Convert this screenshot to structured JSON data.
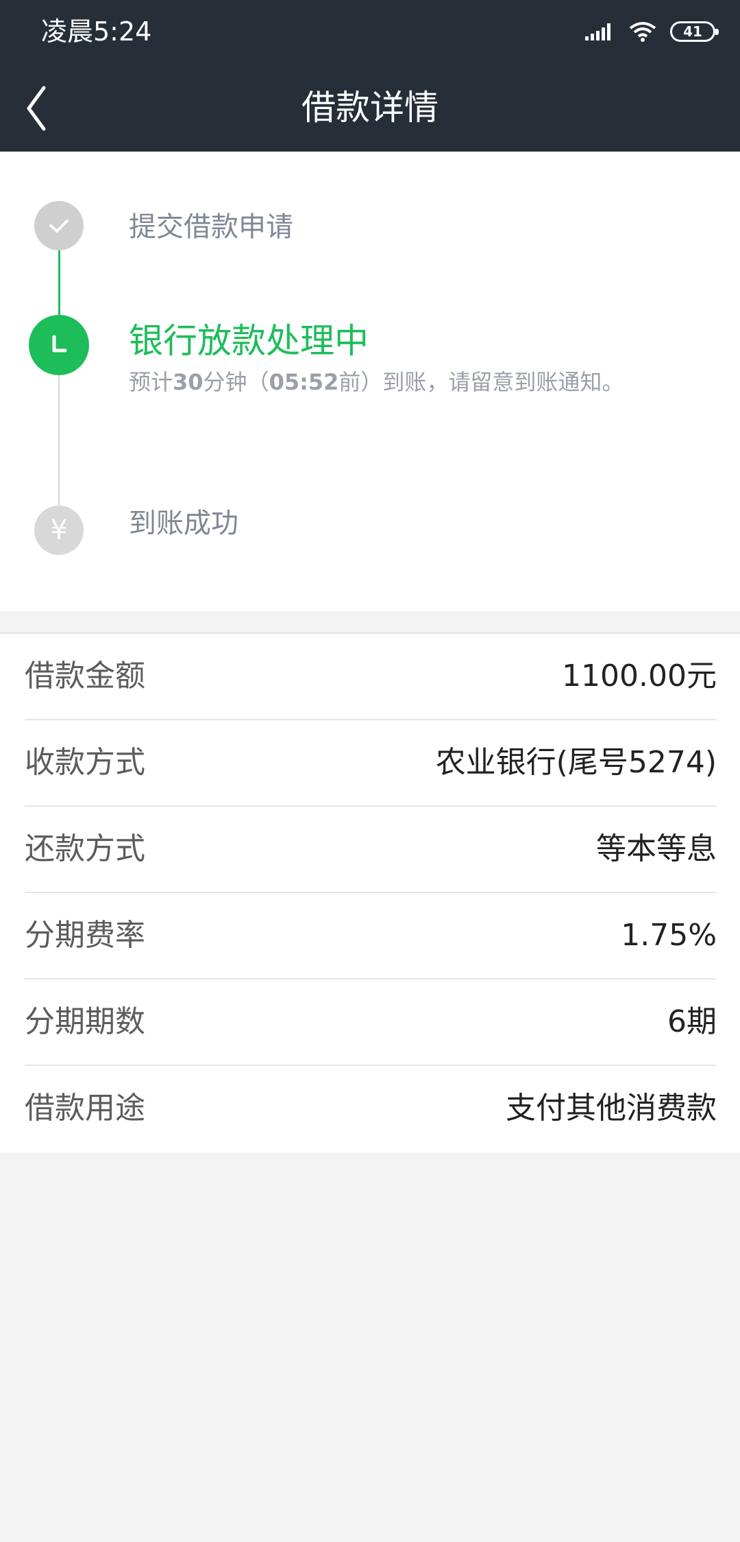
{
  "status_bar": {
    "time": "凌晨5:24",
    "battery": "41"
  },
  "header": {
    "title": "借款详情"
  },
  "timeline": {
    "step1": "提交借款申请",
    "step2": "银行放款处理中",
    "step2_note": {
      "prefix": "预计",
      "minutes": "30",
      "mid": "分钟（",
      "deadline": "05:52",
      "suffix": "前）到账，请留意到账通知。"
    },
    "step3": "到账成功",
    "step3_icon_glyph": "¥"
  },
  "details": [
    {
      "label": "借款金额",
      "value": "1100.00元"
    },
    {
      "label": "收款方式",
      "value": "农业银行(尾号5274)"
    },
    {
      "label": "还款方式",
      "value": "等本等息"
    },
    {
      "label": "分期费率",
      "value": "1.75%"
    },
    {
      "label": "分期期数",
      "value": "6期"
    },
    {
      "label": "借款用途",
      "value": "支付其他消费款"
    }
  ],
  "colors": {
    "accent": "#1dbd5a",
    "header_bg": "#262f37"
  }
}
